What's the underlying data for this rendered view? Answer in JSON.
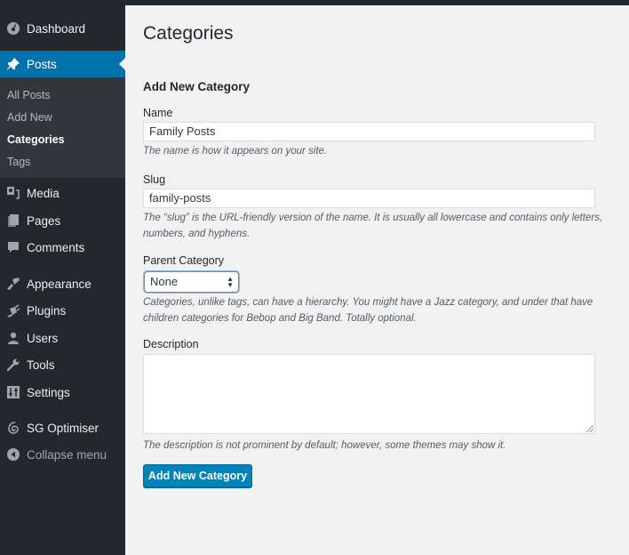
{
  "sidebar": {
    "menu": [
      {
        "id": "dashboard",
        "label": "Dashboard",
        "icon": "dashboard-icon"
      },
      {
        "id": "posts",
        "label": "Posts",
        "icon": "pin-icon",
        "active": true
      },
      {
        "id": "media",
        "label": "Media",
        "icon": "media-icon"
      },
      {
        "id": "pages",
        "label": "Pages",
        "icon": "pages-icon"
      },
      {
        "id": "comments",
        "label": "Comments",
        "icon": "comment-icon"
      },
      {
        "id": "appearance",
        "label": "Appearance",
        "icon": "paintbrush-icon"
      },
      {
        "id": "plugins",
        "label": "Plugins",
        "icon": "plug-icon"
      },
      {
        "id": "users",
        "label": "Users",
        "icon": "user-icon"
      },
      {
        "id": "tools",
        "label": "Tools",
        "icon": "wrench-icon"
      },
      {
        "id": "settings",
        "label": "Settings",
        "icon": "settings-icon"
      },
      {
        "id": "sg-optimiser",
        "label": "SG Optimiser",
        "icon": "sg-optimiser-icon"
      },
      {
        "id": "collapse",
        "label": "Collapse menu",
        "icon": "collapse-icon"
      }
    ],
    "submenu": [
      {
        "label": "All Posts"
      },
      {
        "label": "Add New"
      },
      {
        "label": "Categories",
        "current": true
      },
      {
        "label": "Tags"
      }
    ]
  },
  "main": {
    "page_title": "Categories",
    "section_title": "Add New Category",
    "name": {
      "label": "Name",
      "value": "Family Posts",
      "help": "The name is how it appears on your site."
    },
    "slug": {
      "label": "Slug",
      "value": "family-posts",
      "help": "The “slug” is the URL-friendly version of the name. It is usually all lowercase and contains only letters, numbers, and hyphens."
    },
    "parent": {
      "label": "Parent Category",
      "selected": "None",
      "help": "Categories, unlike tags, can have a hierarchy. You might have a Jazz category, and under that have children categories for Bebop and Big Band. Totally optional."
    },
    "description": {
      "label": "Description",
      "value": "",
      "help": "The description is not prominent by default; however, some themes may show it."
    },
    "submit_label": "Add New Category"
  },
  "colors": {
    "sidebar_bg": "#23282d",
    "submenu_bg": "#32373c",
    "accent": "#0073aa",
    "button": "#0085ba",
    "content_bg": "#f1f1f1"
  }
}
